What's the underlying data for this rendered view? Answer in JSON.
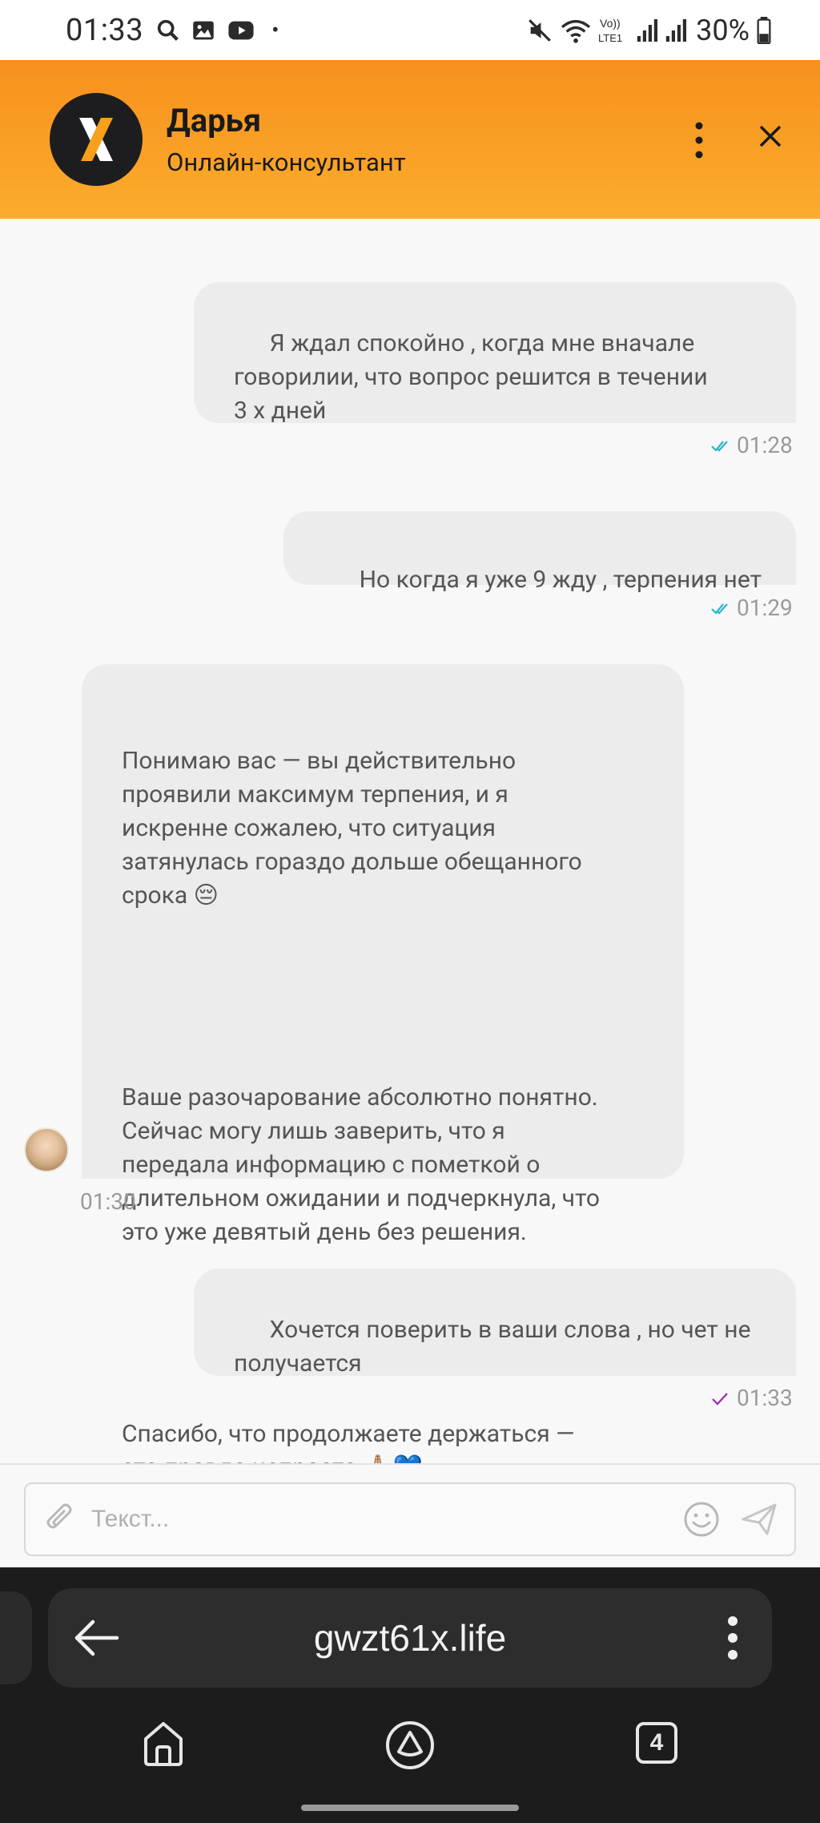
{
  "status_bar": {
    "time": "01:33",
    "icons": [
      "search-icon",
      "image-icon",
      "youtube-icon",
      "dot"
    ],
    "right_icons": [
      "mute-icon",
      "wifi-icon",
      "volte-icon",
      "signal-icon",
      "signal-icon",
      "battery-icon"
    ],
    "volte_label": "Vo))\nLTE1",
    "battery": "30%"
  },
  "header": {
    "agent_name": "Дарья",
    "agent_role": "Онлайн-консультант",
    "logo_icon": "x-logo-icon",
    "colors": {
      "gradient_top": "#f7901e",
      "gradient_bottom": "#fbac2c"
    }
  },
  "messages": [
    {
      "direction": "outgoing",
      "text": "Я ждал спокойно , когда мне вначале\nговорилии, что вопрос решится в течении\n3 х дней",
      "time": "01:28",
      "status": "read"
    },
    {
      "direction": "outgoing",
      "text": "Но когда я уже 9 жду , терпения нет",
      "time": "01:29",
      "status": "read"
    },
    {
      "direction": "incoming",
      "text_p1": "Понимаю вас — вы действительно\nпроявили максимум терпения, и я\nискренне сожалею, что ситуация\nзатянулась гораздо дольше обещанного\nсрока",
      "emoji_p1": "😔",
      "text_p2": "Ваше разочарование абсолютно понятно.\nСейчас могу лишь заверить, что я\nпередала информацию с пометкой о\nдлительном ожидании и подчеркнула, что\nэто уже девятый день без решения.",
      "text_p3": "Спасибо, что продолжаете держаться —\nэто правда непросто",
      "emoji_p3": "🙏🏼💙",
      "time": "01:30"
    },
    {
      "direction": "outgoing",
      "text": "Хочется поверить в ваши слова , но чет не\nполучается",
      "time": "01:33",
      "status": "sent"
    }
  ],
  "composer": {
    "placeholder": "Текст..."
  },
  "browser": {
    "url": "gwzt61x.life",
    "tab_count": "4"
  }
}
